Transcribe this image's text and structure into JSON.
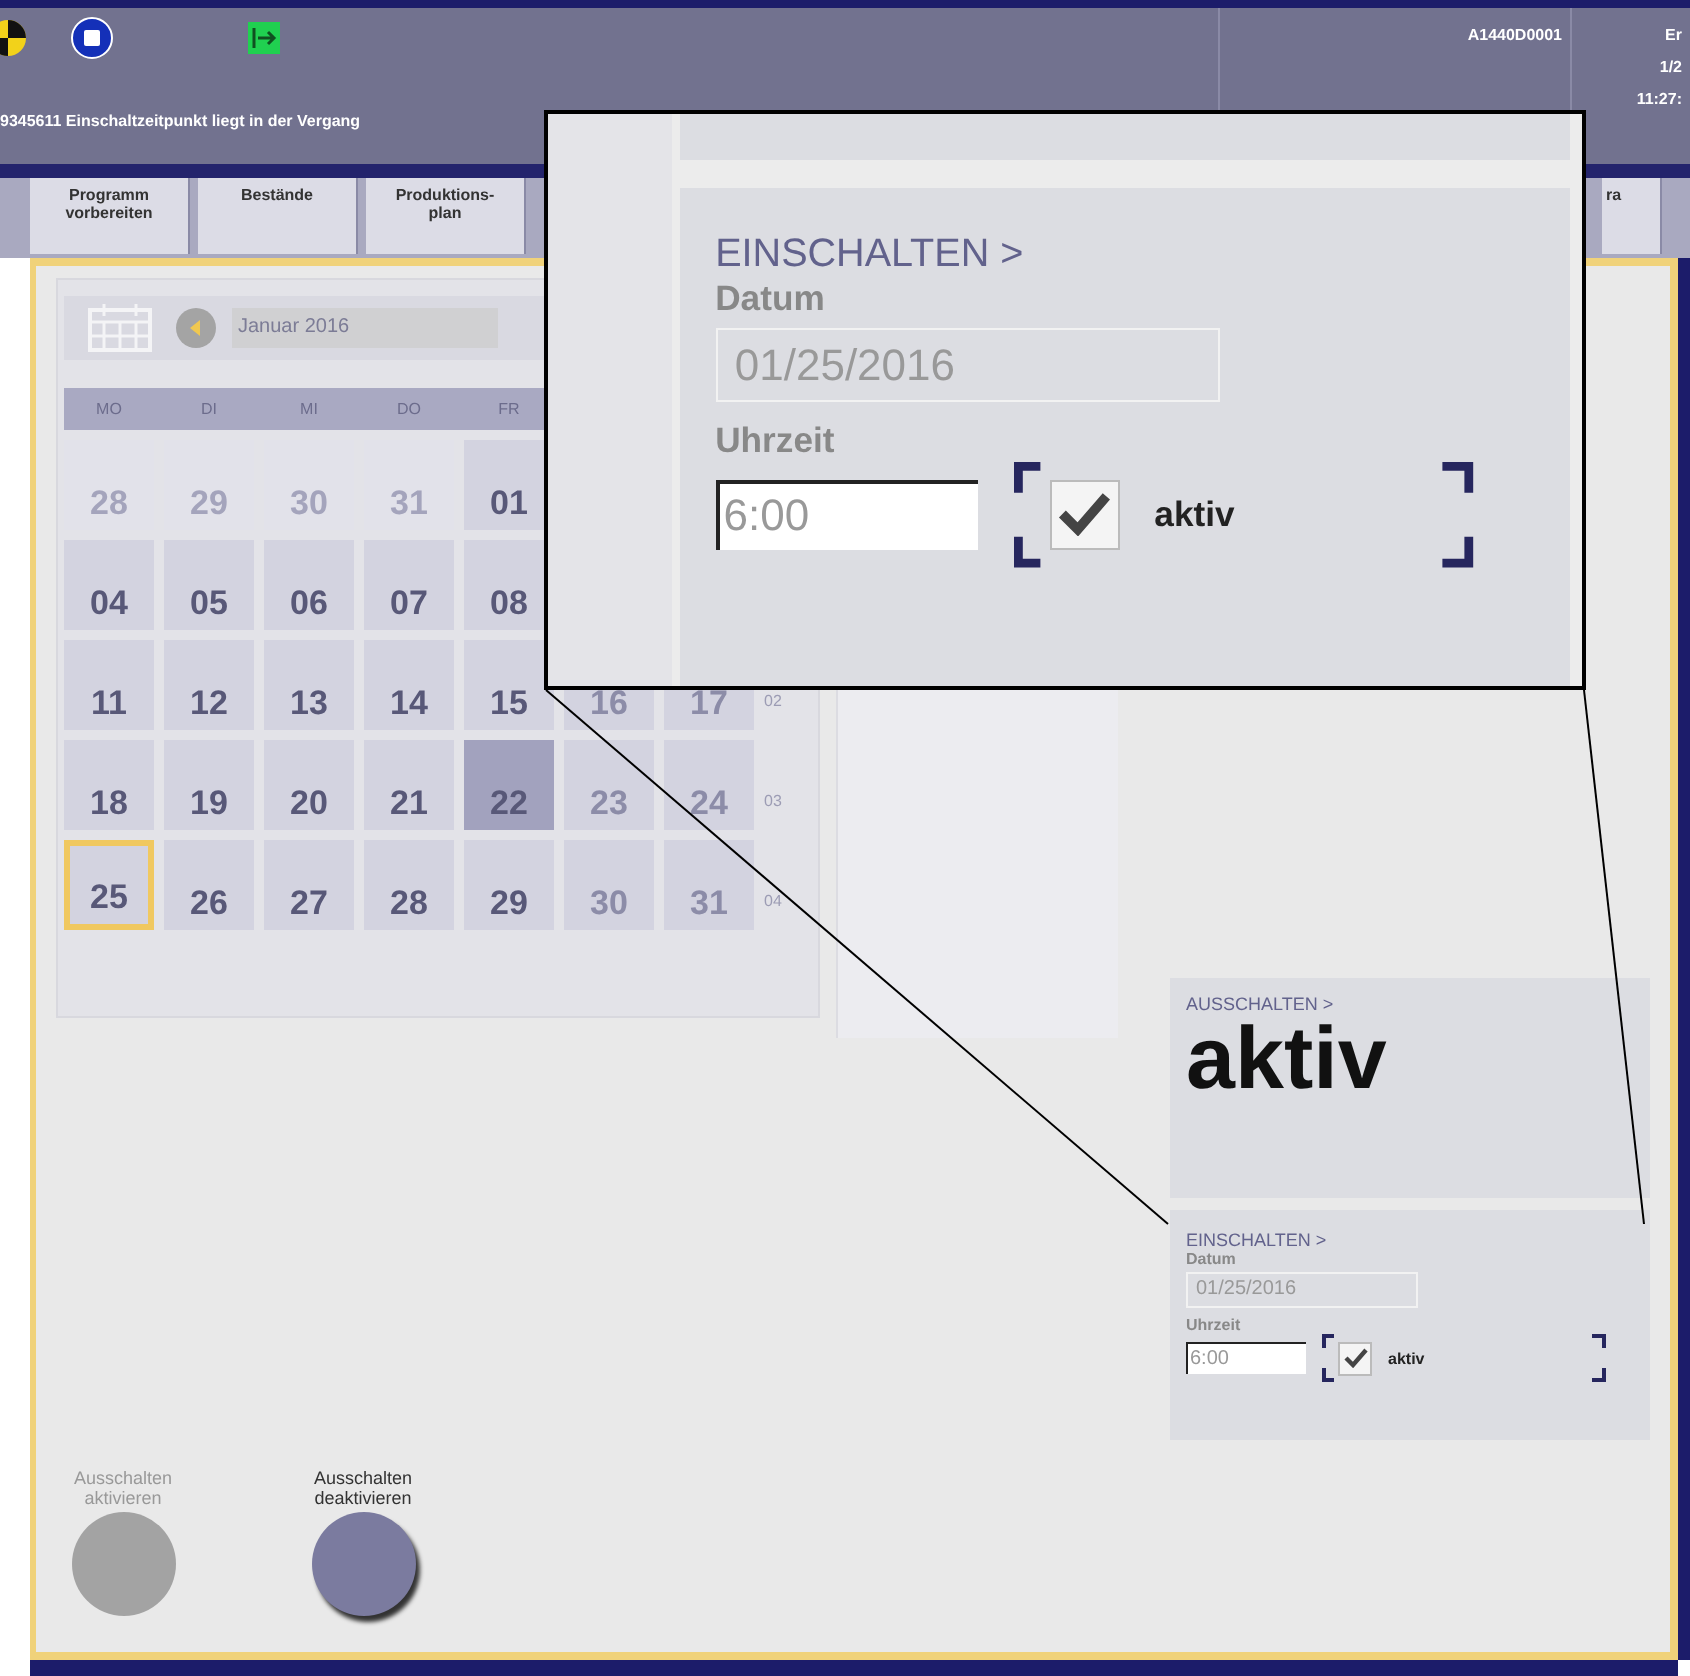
{
  "header": {
    "device_id": "A1440D0001",
    "message": "9345611  Einschaltzeitpunkt liegt in der Vergang",
    "corner_lines": [
      "Er",
      "1/2",
      "11:27:"
    ]
  },
  "tabs": [
    {
      "label": "Programm\nvorbereiten",
      "selected": false
    },
    {
      "label": "Bestände",
      "selected": false
    },
    {
      "label": "Produktions-\nplan",
      "selected": false
    },
    {
      "label": "ra",
      "selected": false
    }
  ],
  "calendar": {
    "month": "Januar 2016",
    "weekdays": [
      "MO",
      "DI",
      "MI",
      "DO",
      "FR"
    ],
    "weeks": [
      {
        "days": [
          {
            "label": "28",
            "kind": "outside",
            "selected": false
          },
          {
            "label": "29",
            "kind": "outside",
            "selected": false
          },
          {
            "label": "30",
            "kind": "outside",
            "selected": false
          },
          {
            "label": "31",
            "kind": "outside",
            "selected": false
          },
          {
            "label": "01",
            "kind": "weekday",
            "selected": false
          }
        ]
      },
      {
        "days": [
          {
            "label": "04",
            "kind": "weekday",
            "selected": false
          },
          {
            "label": "05",
            "kind": "weekday",
            "selected": false
          },
          {
            "label": "06",
            "kind": "weekday",
            "selected": false
          },
          {
            "label": "07",
            "kind": "weekday",
            "selected": false
          },
          {
            "label": "08",
            "kind": "weekday",
            "selected": false
          }
        ]
      },
      {
        "week_number": "02",
        "days": [
          {
            "label": "11",
            "kind": "weekday",
            "selected": false
          },
          {
            "label": "12",
            "kind": "weekday",
            "selected": false
          },
          {
            "label": "13",
            "kind": "weekday",
            "selected": false
          },
          {
            "label": "14",
            "kind": "weekday",
            "selected": false
          },
          {
            "label": "15",
            "kind": "weekday",
            "selected": false
          },
          {
            "label": "16",
            "kind": "weekend",
            "selected": false
          },
          {
            "label": "17",
            "kind": "weekend",
            "selected": false
          }
        ]
      },
      {
        "week_number": "03",
        "days": [
          {
            "label": "18",
            "kind": "weekday",
            "selected": false
          },
          {
            "label": "19",
            "kind": "weekday",
            "selected": false
          },
          {
            "label": "20",
            "kind": "weekday",
            "selected": false
          },
          {
            "label": "21",
            "kind": "weekday",
            "selected": false
          },
          {
            "label": "22",
            "kind": "today",
            "selected": false
          },
          {
            "label": "23",
            "kind": "weekend",
            "selected": false
          },
          {
            "label": "24",
            "kind": "weekend",
            "selected": false
          }
        ]
      },
      {
        "week_number": "04",
        "days": [
          {
            "label": "25",
            "kind": "weekday",
            "selected": true
          },
          {
            "label": "26",
            "kind": "weekday",
            "selected": false
          },
          {
            "label": "27",
            "kind": "weekday",
            "selected": false
          },
          {
            "label": "28",
            "kind": "weekday",
            "selected": false
          },
          {
            "label": "29",
            "kind": "weekday",
            "selected": false
          },
          {
            "label": "30",
            "kind": "weekend",
            "selected": false
          },
          {
            "label": "31",
            "kind": "weekend",
            "selected": false
          }
        ]
      }
    ]
  },
  "off_panel": {
    "heading": "AUSSCHALTEN >",
    "status": "aktiv"
  },
  "on_panel": {
    "heading": "EINSCHALTEN >",
    "date_label": "Datum",
    "date_value": "01/25/2016",
    "time_label": "Uhrzeit",
    "time_value": "6:00",
    "active_label": "aktiv",
    "active_checked": true
  },
  "callout": {
    "heading": "EINSCHALTEN >",
    "date_label": "Datum",
    "date_value": "01/25/2016",
    "time_label": "Uhrzeit",
    "time_value": "6:00",
    "active_label": "aktiv",
    "active_checked": true
  },
  "buttons": [
    {
      "label": "Ausschalten\naktivieren",
      "disabled": true
    },
    {
      "label": "Ausschalten\ndeaktivieren",
      "disabled": false
    }
  ]
}
